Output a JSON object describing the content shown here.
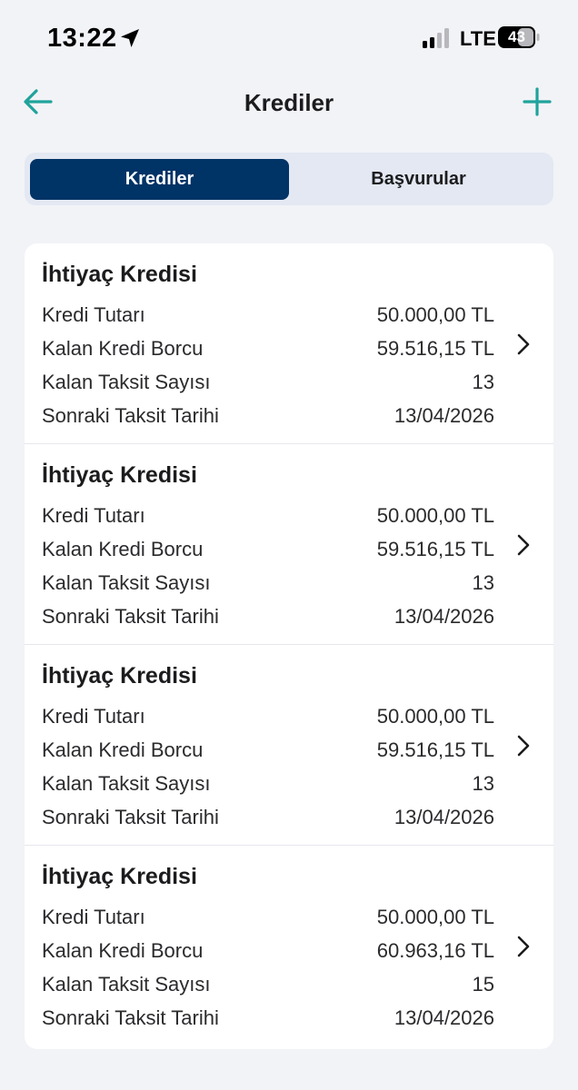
{
  "status": {
    "time": "13:22",
    "network": "LTE",
    "battery": "43"
  },
  "nav": {
    "title": "Krediler",
    "back_icon": "back-arrow-icon",
    "add_icon": "plus-icon"
  },
  "tabs": [
    {
      "label": "Krediler",
      "selected": true
    },
    {
      "label": "Başvurular",
      "selected": false
    }
  ],
  "colors": {
    "accent": "#1fa39b",
    "primary": "#003366",
    "background": "#f2f3f7"
  },
  "loans": [
    {
      "title": "İhtiyaç Kredisi",
      "rows": [
        {
          "label": "Kredi Tutarı",
          "value": "50.000,00 TL"
        },
        {
          "label": "Kalan Kredi Borcu",
          "value": "59.516,15 TL"
        },
        {
          "label": "Kalan Taksit Sayısı",
          "value": "13"
        },
        {
          "label": "Sonraki Taksit Tarihi",
          "value": "13/04/2026"
        }
      ]
    },
    {
      "title": "İhtiyaç Kredisi",
      "rows": [
        {
          "label": "Kredi Tutarı",
          "value": "50.000,00 TL"
        },
        {
          "label": "Kalan Kredi Borcu",
          "value": "59.516,15 TL"
        },
        {
          "label": "Kalan Taksit Sayısı",
          "value": "13"
        },
        {
          "label": "Sonraki Taksit Tarihi",
          "value": "13/04/2026"
        }
      ]
    },
    {
      "title": "İhtiyaç Kredisi",
      "rows": [
        {
          "label": "Kredi Tutarı",
          "value": "50.000,00 TL"
        },
        {
          "label": "Kalan Kredi Borcu",
          "value": "59.516,15 TL"
        },
        {
          "label": "Kalan Taksit Sayısı",
          "value": "13"
        },
        {
          "label": "Sonraki Taksit Tarihi",
          "value": "13/04/2026"
        }
      ]
    },
    {
      "title": "İhtiyaç Kredisi",
      "rows": [
        {
          "label": "Kredi Tutarı",
          "value": "50.000,00 TL"
        },
        {
          "label": "Kalan Kredi Borcu",
          "value": "60.963,16 TL"
        },
        {
          "label": "Kalan Taksit Sayısı",
          "value": "15"
        },
        {
          "label": "Sonraki Taksit Tarihi",
          "value": "13/04/2026"
        }
      ]
    }
  ]
}
